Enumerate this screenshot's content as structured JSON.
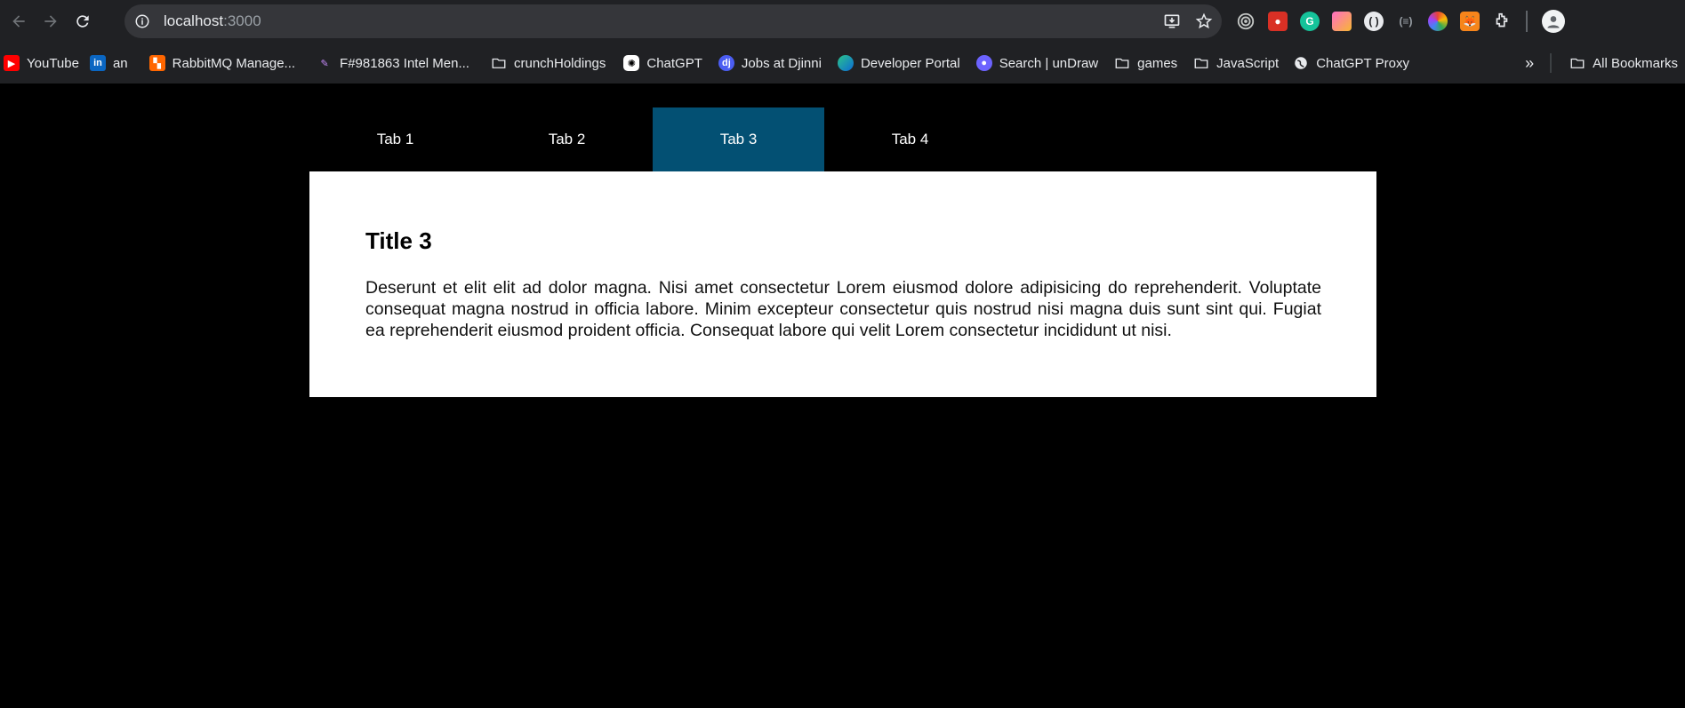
{
  "browser": {
    "url_host": "localhost",
    "url_port": ":3000"
  },
  "bookmarks": {
    "items": [
      {
        "label": "YouTube",
        "icon": "youtube-icon"
      },
      {
        "label": "an",
        "icon": "linkedin-icon"
      },
      {
        "label": "RabbitMQ Manage...",
        "icon": "rabbitmq-icon"
      },
      {
        "label": "F#981863 Intel Men...",
        "icon": "intel-icon"
      },
      {
        "label": "crunchHoldings",
        "icon": "folder-icon"
      },
      {
        "label": "ChatGPT",
        "icon": "chatgpt-icon"
      },
      {
        "label": "Jobs at Djinni",
        "icon": "djinni-icon"
      },
      {
        "label": "Developer Portal",
        "icon": "edge-icon"
      },
      {
        "label": "Search | unDraw",
        "icon": "undraw-icon"
      },
      {
        "label": "games",
        "icon": "folder-icon"
      },
      {
        "label": "JavaScript",
        "icon": "folder-icon"
      },
      {
        "label": "ChatGPT Proxy",
        "icon": "globe-icon"
      }
    ],
    "all_bookmarks": "All Bookmarks"
  },
  "tabs": [
    {
      "label": "Tab 1",
      "active": false
    },
    {
      "label": "Tab 2",
      "active": false
    },
    {
      "label": "Tab 3",
      "active": true
    },
    {
      "label": "Tab 4",
      "active": false
    }
  ],
  "panel": {
    "title": "Title 3",
    "body": "Deserunt et elit elit ad dolor magna. Nisi amet consectetur Lorem eiusmod dolore adipisicing do reprehenderit. Voluptate consequat magna nostrud in officia labore. Minim excepteur consectetur quis nostrud nisi magna duis sunt sint qui. Fugiat ea reprehenderit eiusmod proident officia. Consequat labore qui velit Lorem consectetur incididunt ut nisi."
  },
  "colors": {
    "active_tab": "#035073",
    "page_bg": "#000000",
    "panel_bg": "#ffffff"
  }
}
